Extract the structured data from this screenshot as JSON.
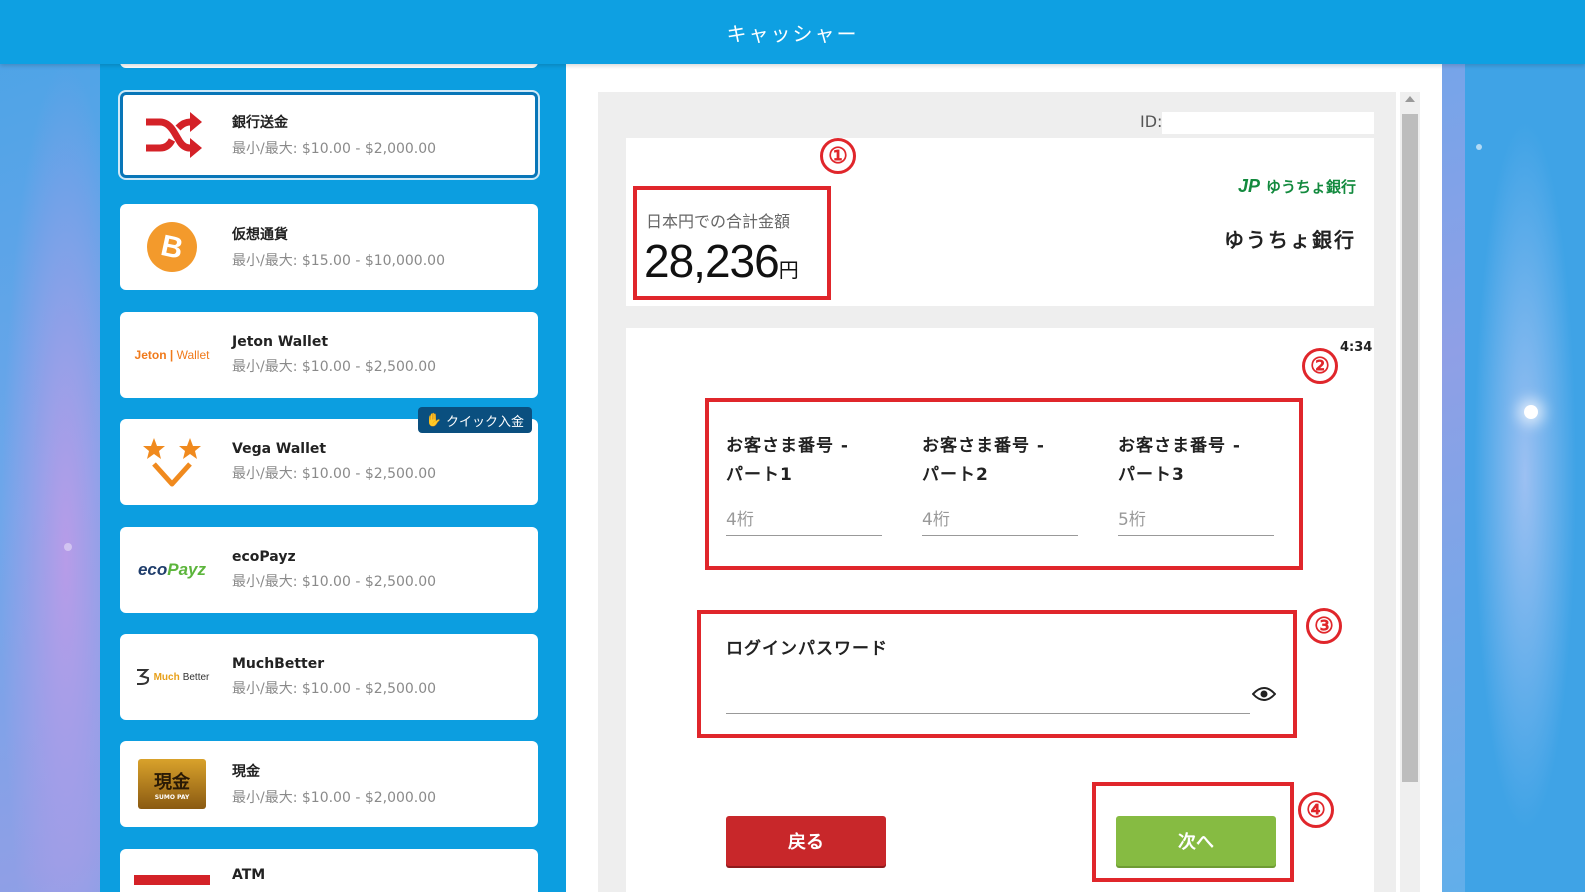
{
  "header": {
    "title": "キャッシャー"
  },
  "sidebar": {
    "methods": [
      {
        "name": "銀行送金",
        "limits": "最小/最大: $10.00 - $2,000.00",
        "icon": "shuffle-icon"
      },
      {
        "name": "仮想通貨",
        "limits": "最小/最大: $15.00 - $10,000.00",
        "icon": "bitcoin-icon"
      },
      {
        "name": "Jeton Wallet",
        "limits": "最小/最大: $10.00 - $2,500.00",
        "icon": "jeton-logo"
      },
      {
        "name": "Vega Wallet",
        "limits": "最小/最大: $10.00 - $2,500.00",
        "icon": "vega-logo",
        "badge": "クイック入金"
      },
      {
        "name": "ecoPayz",
        "limits": "最小/最大: $10.00 - $2,500.00",
        "icon": "ecopayz-logo"
      },
      {
        "name": "MuchBetter",
        "limits": "最小/最大: $10.00 - $2,500.00",
        "icon": "muchbetter-logo"
      },
      {
        "name": "現金",
        "limits": "最小/最大: $10.00 - $2,000.00",
        "icon": "cash-logo"
      },
      {
        "name": "ATM",
        "limits": "",
        "icon": "atm-logo"
      }
    ],
    "logo_text": {
      "jeton": "Jeton",
      "jeton_suffix": "Wallet",
      "eco_prefix": "eco",
      "eco_suffix": "Payz",
      "much_prefix": "Much",
      "much_suffix": "Better",
      "cash_text": "現金",
      "cash_sub": "SUMO PAY"
    }
  },
  "main": {
    "id_label": "ID:",
    "amount": {
      "label": "日本円での合計金額",
      "value": "28,236",
      "unit": "円"
    },
    "bank": {
      "logo_mark": "JP",
      "logo_text": "ゆうちょ銀行",
      "name": "ゆうちょ銀行"
    },
    "timer": "4:34",
    "fields": [
      {
        "label_line1": "お客さま番号 -",
        "label_line2": "パート1",
        "placeholder": "4桁"
      },
      {
        "label_line1": "お客さま番号 -",
        "label_line2": "パート2",
        "placeholder": "4桁"
      },
      {
        "label_line1": "お客さま番号 -",
        "label_line2": "パート3",
        "placeholder": "5桁"
      }
    ],
    "password_label": "ログインパスワード",
    "back_button": "戻る",
    "next_button": "次へ"
  },
  "annotations": {
    "markers": [
      "①",
      "②",
      "③",
      "④"
    ],
    "highlight_color": "#e0262b"
  },
  "colors": {
    "header": "#0ea0e2",
    "back_button": "#c8272a",
    "next_button": "#86bb42",
    "bank_green": "#138a3e"
  }
}
